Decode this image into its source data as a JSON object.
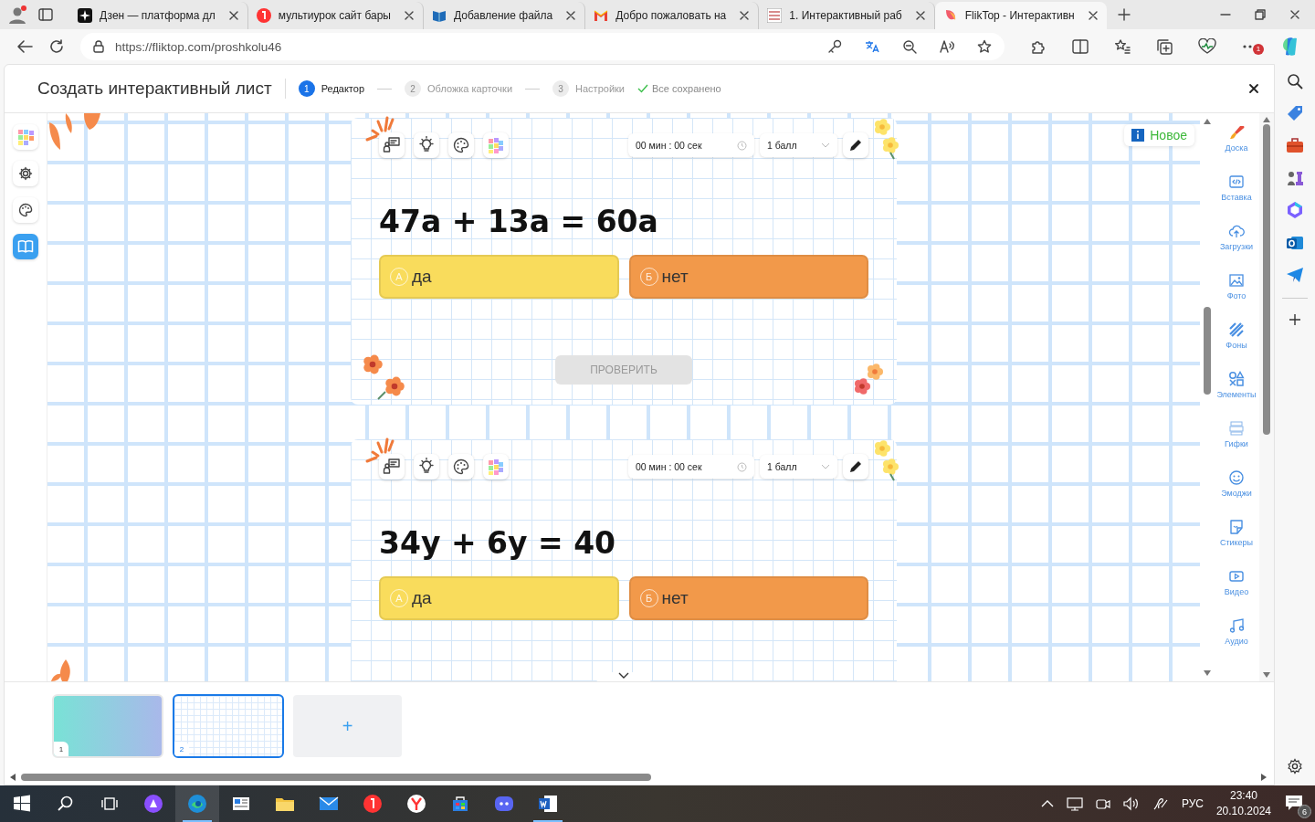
{
  "browser": {
    "tabs": [
      {
        "title": "Дзен — платформа дл",
        "kind": "sparkle",
        "selected": false
      },
      {
        "title": "мультиурок сайт бары",
        "kind": "circle",
        "selected": false
      },
      {
        "title": "Добавление файла",
        "kind": "book",
        "selected": false
      },
      {
        "title": "Добро пожаловать на",
        "kind": "envelope",
        "selected": false
      },
      {
        "title": "1. Интерактивный раб",
        "kind": "grid",
        "selected": false
      },
      {
        "title": "FlikTop - Интерактивн",
        "kind": "petal",
        "selected": true
      }
    ],
    "url": "https://fliktop.com/proshkolu46",
    "more_badge": "1"
  },
  "header": {
    "title": "Создать интерактивный лист",
    "steps": [
      {
        "number": "1",
        "label": "Редактор",
        "selected": true
      },
      {
        "number": "2",
        "label": "Обложка карточки",
        "selected": false
      },
      {
        "number": "3",
        "label": "Настройки",
        "selected": false
      }
    ],
    "status": "Все сохранено"
  },
  "cards": [
    {
      "timer": "00 мин : 00 сек",
      "points": "1 балл",
      "question": "47a + 13a = 60a",
      "answers": [
        {
          "letter": "A",
          "text": "да",
          "color": "#f9dc5c"
        },
        {
          "letter": "Б",
          "text": "нет",
          "color": "#f2994a"
        }
      ],
      "check_button": {
        "label": "ПРОВЕРИТЬ",
        "disabled": true
      }
    },
    {
      "timer": "00 мин : 00 сек",
      "points": "1 балл",
      "question": "34y + 6y = 40",
      "answers": [
        {
          "letter": "A",
          "text": "да",
          "color": "#f9dc5c"
        },
        {
          "letter": "Б",
          "text": "нет",
          "color": "#f2994a"
        }
      ]
    }
  ],
  "new_badge": "Новое",
  "tools": [
    {
      "label": "Доска",
      "kind": "brush"
    },
    {
      "label": "Вставка",
      "kind": "code"
    },
    {
      "label": "Загрузки",
      "kind": "cloud"
    },
    {
      "label": "Фото",
      "kind": "photo"
    },
    {
      "label": "Фоны",
      "kind": "stripes"
    },
    {
      "label": "Элементы",
      "kind": "shapes"
    },
    {
      "label": "Гифки",
      "kind": "gif"
    },
    {
      "label": "Эмоджи",
      "kind": "emoji"
    },
    {
      "label": "Стикеры",
      "kind": "sticker"
    },
    {
      "label": "Видео",
      "kind": "video"
    },
    {
      "label": "Аудио",
      "kind": "audio"
    }
  ],
  "slides": [
    {
      "number": "1",
      "kind": "gradient",
      "selected": false
    },
    {
      "number": "2",
      "kind": "grid",
      "selected": true
    }
  ],
  "add_slide": "+",
  "taskbar": {
    "language": "РУС",
    "time": "23:40",
    "date": "20.10.2024",
    "notifications": "6"
  }
}
